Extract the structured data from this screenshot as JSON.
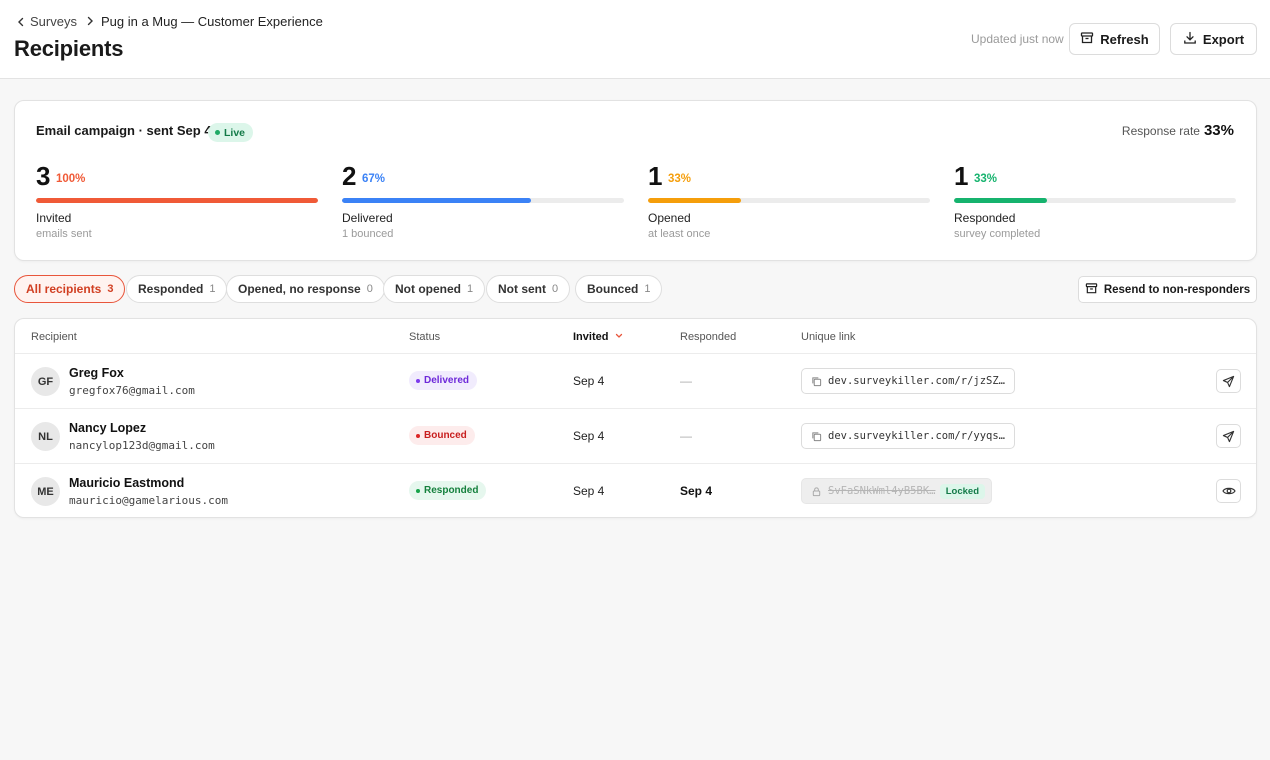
{
  "header": {
    "breadcrumb": {
      "parent": "Surveys",
      "current": "Pug in a Mug — Customer Experience"
    },
    "title": "Recipients",
    "updated": "Updated just now",
    "refresh_label": "Refresh",
    "export_label": "Export"
  },
  "campaign": {
    "title": "Email campaign · sent Sep 4",
    "live_label": "Live",
    "response_rate_label": "Response rate",
    "response_rate_value": "33%",
    "stats": [
      {
        "count": "3",
        "pct": "100%",
        "fraction": 1.0,
        "label": "Invited",
        "sub": "emails sent",
        "color": "#f05a37"
      },
      {
        "count": "2",
        "pct": "67%",
        "fraction": 0.67,
        "label": "Delivered",
        "sub": "1 bounced",
        "color": "#3b82f6"
      },
      {
        "count": "1",
        "pct": "33%",
        "fraction": 0.33,
        "label": "Opened",
        "sub": "at least once",
        "color": "#f59e0b"
      },
      {
        "count": "1",
        "pct": "33%",
        "fraction": 0.33,
        "label": "Responded",
        "sub": "survey completed",
        "color": "#16b36e"
      }
    ]
  },
  "filters": [
    {
      "label": "All recipients",
      "count": "3",
      "active": true
    },
    {
      "label": "Responded",
      "count": "1"
    },
    {
      "label": "Opened, no response",
      "count": "0"
    },
    {
      "label": "Not opened",
      "count": "1"
    },
    {
      "label": "Not sent",
      "count": "0"
    },
    {
      "label": "Bounced",
      "count": "1"
    }
  ],
  "resend_label": "Resend to non-responders",
  "table": {
    "columns": {
      "recipient": "Recipient",
      "status": "Status",
      "invited": "Invited",
      "responded": "Responded",
      "link": "Unique link"
    },
    "rows": [
      {
        "initials": "GF",
        "name": "Greg Fox",
        "email": "gregfox76@gmail.com",
        "status": "Delivered",
        "invited": "Sep 4",
        "responded": "—",
        "link": "dev.surveykiller.com/r/jzSZ…"
      },
      {
        "initials": "NL",
        "name": "Nancy Lopez",
        "email": "nancylop123d@gmail.com",
        "status": "Bounced",
        "invited": "Sep 4",
        "responded": "—",
        "link": "dev.surveykiller.com/r/yyqs…"
      },
      {
        "initials": "ME",
        "name": "Mauricio Eastmond",
        "email": "mauricio@gamelarious.com",
        "status": "Responded",
        "invited": "Sep 4",
        "responded": "Sep 4",
        "link": "SvFaSNkWml4yB5BK…",
        "locked_label": "Locked"
      }
    ]
  },
  "colors": {
    "accent": "#e8553b",
    "delivered": "#7c3aed",
    "bounced": "#dc2626",
    "responded": "#16a34a"
  }
}
